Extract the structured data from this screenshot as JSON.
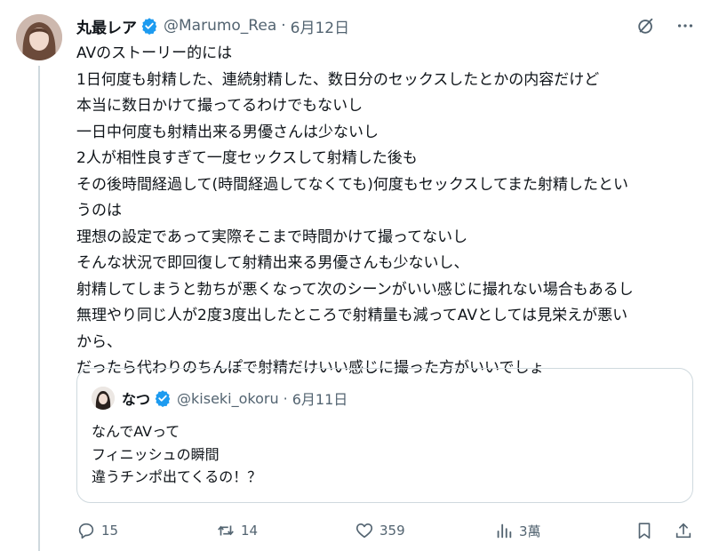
{
  "tweet": {
    "author_name": "丸最レア",
    "author_handle": "@Marumo_Rea",
    "date": "6月12日",
    "lines": [
      "AVのストーリー的には",
      "1日何度も射精した、連続射精した、数日分のセックスしたとかの内容だけど",
      "本当に数日かけて撮ってるわけでもないし",
      "一日中何度も射精出来る男優さんは少ないし",
      "2人が相性良すぎて一度セックスして射精した後も",
      "その後時間経過して(時間経過してなくても)何度もセックスしてまた射精したとい",
      "うのは",
      "理想の設定であって実際そこまで時間かけて撮ってないし",
      "そんな状況で即回復して射精出来る男優さんも少ないし、",
      "射精してしまうと勃ちが悪くなって次のシーンがいい感じに撮れない場合もあるし",
      "無理やり同じ人が2度3度出したところで射精量も減ってAVとしては見栄えが悪い",
      "から、",
      "だったら代わりのちんぽで射精だけいい感じに撮った方がいいでしょ"
    ]
  },
  "quote": {
    "author_name": "なつ",
    "author_handle": "@kiseki_okoru",
    "date": "6月11日",
    "lines": [
      "なんでAVって",
      "フィニッシュの瞬間",
      "違うチンポ出てくるの！？"
    ]
  },
  "actions": {
    "replies": "15",
    "reposts": "14",
    "likes": "359",
    "views": "3萬"
  },
  "separator": "·",
  "colors": {
    "verified": "#1d9bf0",
    "muted": "#536471",
    "text": "#0f1419",
    "border": "#cfd9de"
  },
  "icons": [
    "grok-icon",
    "more-icon",
    "reply-icon",
    "repost-icon",
    "like-icon",
    "views-icon",
    "bookmark-icon",
    "share-icon"
  ]
}
